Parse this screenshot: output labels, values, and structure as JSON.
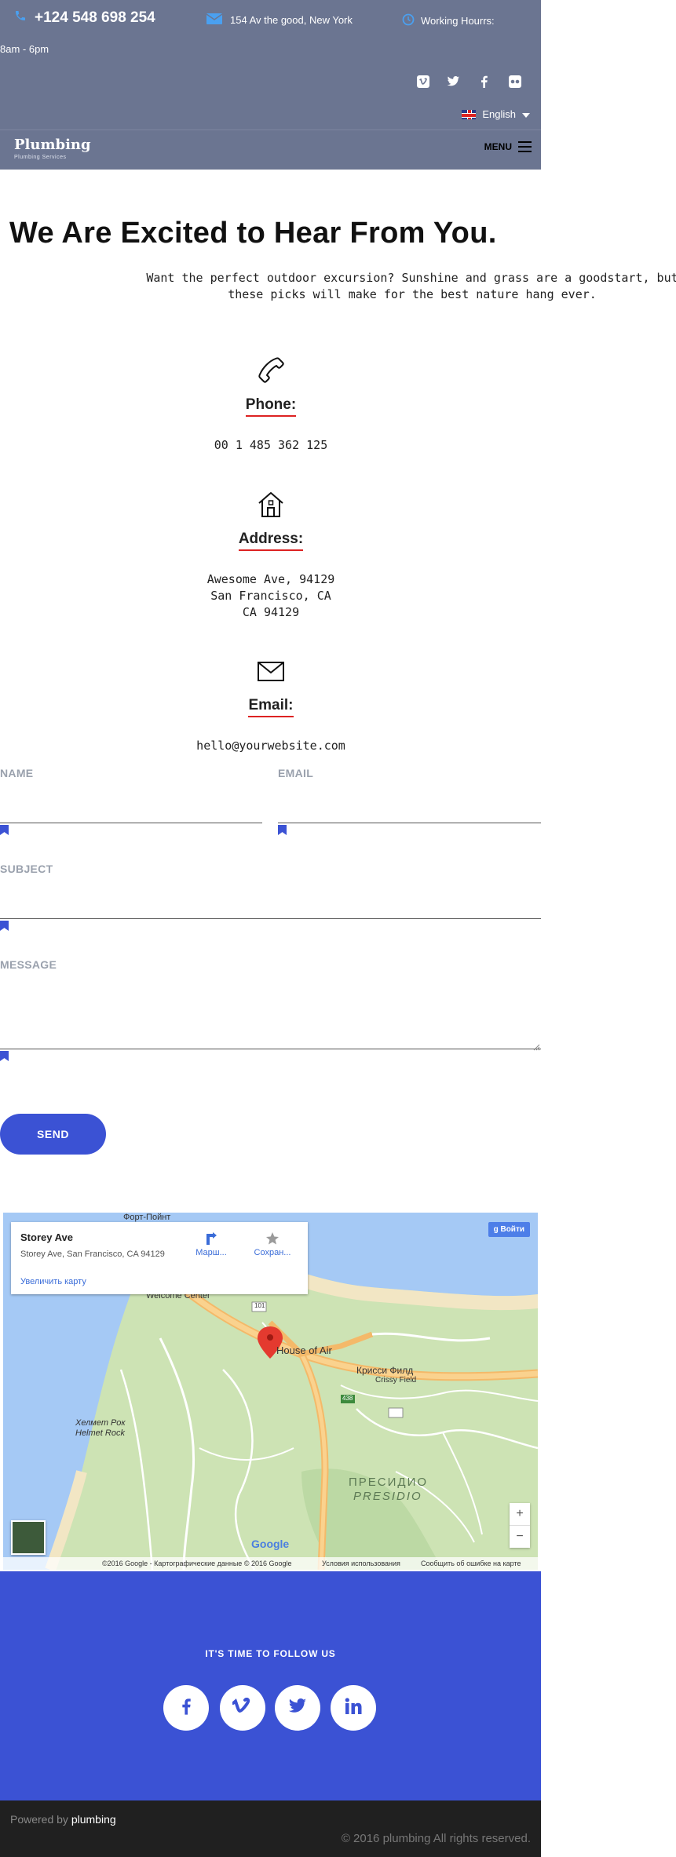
{
  "topbar": {
    "phone": "+124 548 698 254",
    "address": "154 Av the good, New York",
    "hours_label": "Working Hourrs:",
    "hours_value": "8am - 6pm",
    "language": "English"
  },
  "navbar": {
    "logo": "Plumbing",
    "logo_sub": "Plumbing Services",
    "menu": "MENU"
  },
  "hero": {
    "title": "We Are Excited to Hear From You.",
    "intro": "Want the perfect outdoor excursion? Sunshine and grass are a goodstart, but these picks will make for the best nature hang ever."
  },
  "contact": {
    "phone_label": "Phone:",
    "phone_value": "00 1 485 362 125",
    "address_label": "Address:",
    "address_line1": "Awesome Ave, 94129",
    "address_line2": "San Francisco, CA",
    "address_line3": "CA 94129",
    "email_label": "Email:",
    "email_value": "hello@yourwebsite.com"
  },
  "form": {
    "name_label": "NAME",
    "email_label": "EMAIL",
    "subject_label": "SUBJECT",
    "message_label": "MESSAGE",
    "send": "SEND"
  },
  "map": {
    "place_title": "Storey Ave",
    "place_address": "Storey Ave, San Francisco, CA 94129",
    "enlarge": "Увеличить карту",
    "directions": "Марш...",
    "save": "Сохран...",
    "signin": "Войти",
    "labels": {
      "fort_point": "Форт-Пойнт",
      "welcome_center": "Welcome Center",
      "house_of_air": "House of Air",
      "crissy_field_ru": "Крисси Филд",
      "crissy_field": "Crissy Field",
      "helmet_rock_ru": "Хелмет Рок",
      "helmet_rock": "Helmet Rock",
      "presidio_ru": "ПРЕСИДИО",
      "presidio": "PRESIDIO",
      "route_101": "101",
      "route_438": "438"
    },
    "footer": {
      "copyright": "©2016 Google - Картографические данные © 2016 Google",
      "terms": "Условия использования",
      "report": "Сообщить об ошибке на карте"
    },
    "brand": "Google",
    "zoom_in": "+",
    "zoom_out": "−"
  },
  "follow": {
    "title": "IT'S TIME TO FOLLOW US"
  },
  "footer": {
    "powered_prefix": "Powered by",
    "powered_brand": "plumbing",
    "copyright": "© 2016 plumbing All rights reserved."
  },
  "colors": {
    "header_bg": "#6b7591",
    "accent": "#3b52d4",
    "underline": "#dd2222",
    "footer_bg": "#202020"
  }
}
